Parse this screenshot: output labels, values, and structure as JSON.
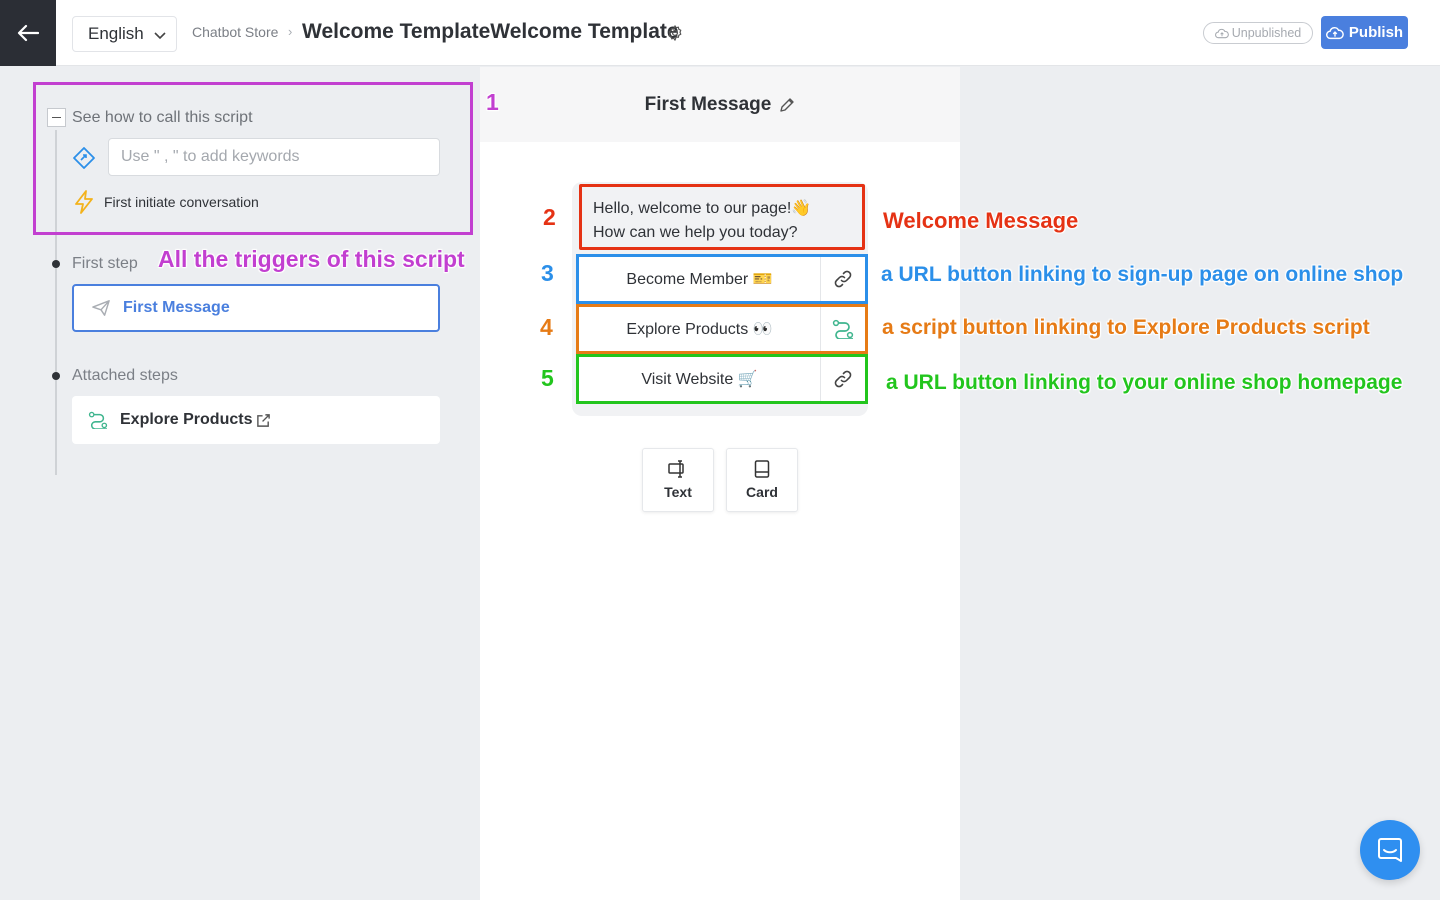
{
  "header": {
    "language": "English",
    "breadcrumb": "Chatbot Store",
    "title": "Welcome TemplateWelcome Template",
    "status": "Unpublished",
    "publish_label": "Publish"
  },
  "trigger": {
    "collapse_label": "See how to call this script",
    "keyword_placeholder": "Use \" , \" to add keywords",
    "initiate_label": "First initiate conversation"
  },
  "steps": {
    "first_step_label": "First step",
    "first_step_name": "First Message",
    "attached_label": "Attached steps",
    "attached_name": "Explore Products"
  },
  "preview": {
    "header_title": "First Message",
    "message_line1": "Hello, welcome to our page!👋",
    "message_line2": "How can we help you today?",
    "buttons": [
      {
        "label": "Become Member 🎫",
        "icon": "link-icon"
      },
      {
        "label": "Explore Products 👀",
        "icon": "script-icon"
      },
      {
        "label": "Visit Website 🛒",
        "icon": "link-icon"
      }
    ],
    "add_text_label": "Text",
    "add_card_label": "Card"
  },
  "annotations": {
    "n1": "1",
    "n2": "2",
    "n3": "3",
    "n4": "4",
    "n5": "5",
    "triggers": "All the triggers of this script",
    "welcome": "Welcome Message",
    "url_signup": "a URL button linking to sign-up page on online shop",
    "script_btn": "a script button linking to Explore Products script",
    "url_home": "a URL button linking to your online shop homepage"
  },
  "colors": {
    "accent": "#4a7fde",
    "annotation_purple": "#c23fd0",
    "annotation_red": "#e53214",
    "annotation_blue": "#2b8fe9",
    "annotation_orange": "#e67b16",
    "annotation_green": "#22c51d"
  }
}
